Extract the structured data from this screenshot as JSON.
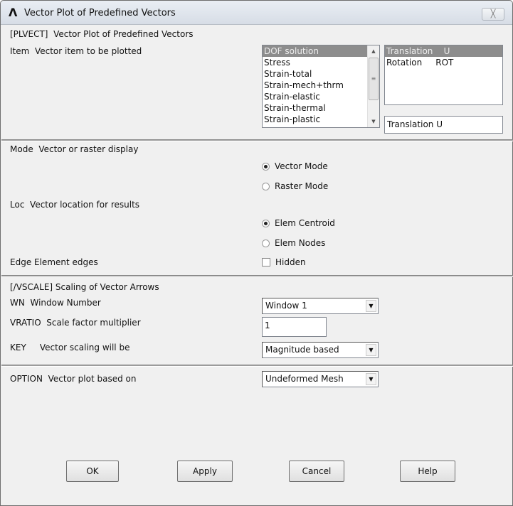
{
  "window": {
    "title": "Vector Plot of Predefined Vectors",
    "close_label": "╳"
  },
  "header": "[PLVECT]  Vector Plot of Predefined Vectors",
  "item": {
    "label": "Item  Vector item to be plotted",
    "categories": [
      "DOF solution",
      "Stress",
      "Strain-total",
      "Strain-mech+thrm",
      "Strain-elastic",
      "Strain-thermal",
      "Strain-plastic"
    ],
    "components": [
      "Translation    U",
      "Rotation     ROT"
    ],
    "selected_value": "Translation    U"
  },
  "mode": {
    "label": "Mode  Vector or raster display",
    "options": [
      "Vector Mode",
      "Raster Mode"
    ]
  },
  "loc": {
    "label": "Loc  Vector location for results",
    "options": [
      "Elem Centroid",
      "Elem Nodes"
    ]
  },
  "edge": {
    "label": "Edge Element edges",
    "checkbox": "Hidden"
  },
  "vscale": {
    "header": "[/VSCALE] Scaling of Vector Arrows",
    "wn_label": "WN  Window Number",
    "wn_value": "Window 1",
    "vratio_label": "VRATIO  Scale factor multiplier",
    "vratio_value": "1",
    "key_label": "KEY     Vector scaling will be",
    "key_value": "Magnitude based"
  },
  "option": {
    "label": "OPTION  Vector plot based on",
    "value": "Undeformed Mesh"
  },
  "buttons": {
    "ok": "OK",
    "apply": "Apply",
    "cancel": "Cancel",
    "help": "Help"
  }
}
